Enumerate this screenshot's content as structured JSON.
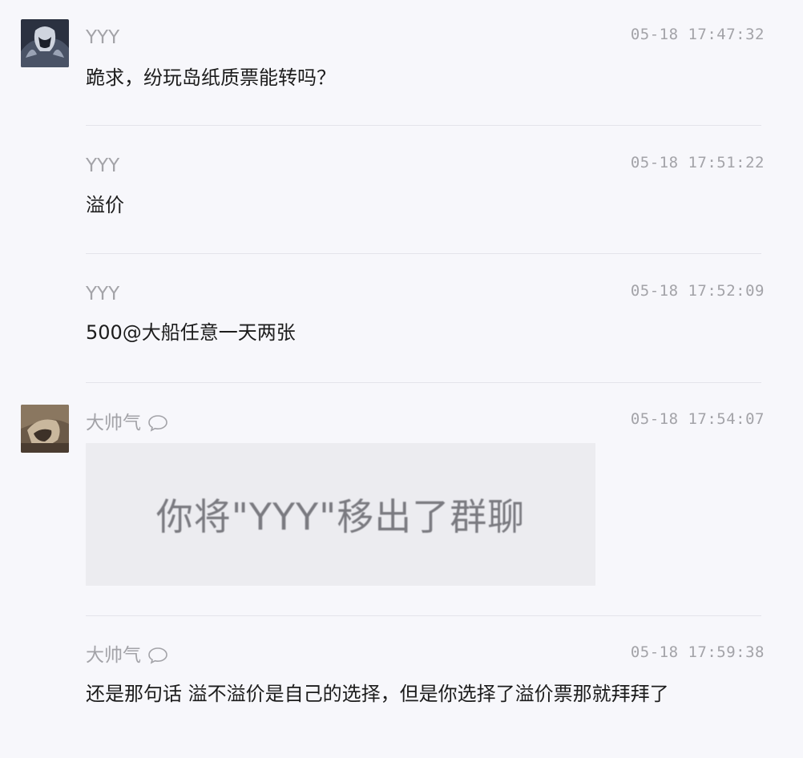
{
  "messages": [
    {
      "sender": "YYY",
      "time": "05-18 17:47:32",
      "text": "跪求，纷玩岛纸质票能转吗？",
      "avatar_icon": "dark-anime-avatar"
    },
    {
      "sender": "YYY",
      "time": "05-18 17:51:22",
      "text": "溢价"
    },
    {
      "sender": "YYY",
      "time": "05-18 17:52:09",
      "text": "500@大船任意一天两张"
    },
    {
      "sender": "大帅气",
      "time": "05-18 17:54:07",
      "system_notice": "你将\"YYY\"移出了群聊",
      "avatar_icon": "brown-photo-avatar",
      "sender_icon": "chat-bubble-icon"
    },
    {
      "sender": "大帅气",
      "time": "05-18 17:59:38",
      "text": "还是那句话 溢不溢价是自己的选择，但是你选择了溢价票那就拜拜了",
      "sender_icon": "chat-bubble-icon"
    }
  ],
  "colors": {
    "background": "#f7f7fb",
    "name_text": "#a3a3a8",
    "message_text": "#1c1c1c",
    "divider": "#e4e4ea",
    "system_card": "#ececf0"
  }
}
